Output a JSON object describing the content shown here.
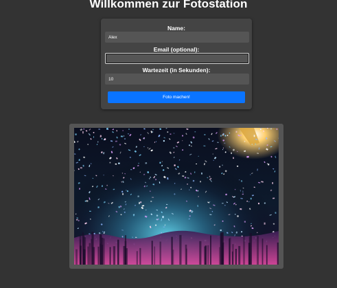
{
  "page": {
    "title": "Willkommen zur Fotostation"
  },
  "form": {
    "name_label": "Name:",
    "name_value": "Alex",
    "email_label": "Email (optional):",
    "email_value": "",
    "wait_label": "Wartezeit (in Sekunden):",
    "wait_value": "10",
    "submit_label": "Foto machen!"
  },
  "photo": {
    "description_icon": "concert-confetti-photo"
  },
  "colors": {
    "background": "#333333",
    "card": "#444444",
    "input": "#555555",
    "button": "#0a74ff"
  }
}
